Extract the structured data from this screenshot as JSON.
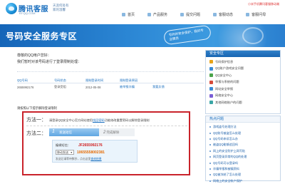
{
  "header": {
    "logo_title": "腾讯客服",
    "logo_url": "KF.QQ.COM",
    "slogan_line1": "天涯何处有",
    "slogan_line2": "家的温馨",
    "top_link": "小米手机腾讯客服移动端",
    "nav": [
      {
        "label": "首页"
      },
      {
        "label": "产品服务"
      },
      {
        "label": "提交问题"
      },
      {
        "label": "客服动态"
      },
      {
        "label": "客服问母"
      }
    ]
  },
  "banner": {
    "title": "号码安全服务专区",
    "bubble": "号码的安全保护，我的专业服务"
  },
  "main": {
    "greeting": "尊敬的QQ用户您好：",
    "notice": "我们暂时对该号码进行了登录限制处理：",
    "table": {
      "headers": [
        "QQ号码",
        "号码状态",
        "限制登录时间",
        "限制登录原因",
        ""
      ],
      "row": [
        "2655992176",
        "登录受阻",
        "2012-05-08",
        "被举报诈骗",
        "我要反馈"
      ]
    },
    "unlock_heading": "请按照以下提示解除登录限制",
    "method1": {
      "label": "方法一：",
      "text_before": "请登录QQ安全中心官方网站使用",
      "link": "找回密码",
      "text_after": "功能修改重置密码以解除登录限制"
    },
    "method2": {
      "label": "方法二：",
      "step1_num": "1",
      "step1_text": "发送短信",
      "step2_num": "2",
      "step2_text": "完成解除",
      "code_label": "编辑短信：",
      "code_value": "JF2655992176",
      "send_select": "移动发送",
      "send_to": "10655558002381",
      "note_before": "发送后请等待数秒，点击这里",
      "note_link": "查询结果"
    }
  },
  "sidebar": {
    "security_title": "安全专区",
    "security_items": [
      {
        "label": "号码保护信息",
        "color": "#e8a317"
      },
      {
        "label": "QQ账户游戏安全问题",
        "color": "#3a8bd6"
      },
      {
        "label": "QQ安全中心",
        "color": "#4aa44a"
      },
      {
        "label": "举报与系统的问题",
        "color": "#d64a3a"
      },
      {
        "label": "网站安全举报",
        "color": "#3a8bd6"
      },
      {
        "label": "网络安全中心",
        "color": "#7a5ed6"
      },
      {
        "label": "其他网络账户的问题",
        "color": "#3aa6a6"
      }
    ],
    "hot_title": "热点问题",
    "hot_items": [
      {
        "label": "游戏盗号处理方法"
      },
      {
        "label": "QQ账号被盗怎么处理"
      },
      {
        "label": "QQ号码申诉怎么办"
      },
      {
        "label": "被盗QQ能够追回吗"
      },
      {
        "label": "网上的安全防护上网写贴"
      },
      {
        "label": "网页登录异常的QQ的处理"
      },
      {
        "label": "QQ号码可以登录吗"
      },
      {
        "label": "诈骗举报和被骗资料"
      },
      {
        "label": "QQ被冻结了怎么处理"
      },
      {
        "label": "网络上的安全帐户保护"
      }
    ]
  }
}
